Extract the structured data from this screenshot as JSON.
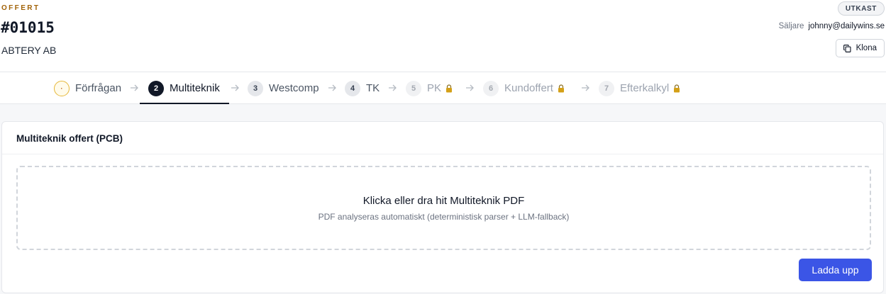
{
  "header": {
    "eyebrow": "OFFERT",
    "order_number": "#01015",
    "customer": "ABTERY AB",
    "status_badge": "UTKAST",
    "seller_label": "Säljare",
    "seller_value": "johnny@dailywins.se",
    "clone_label": "Klona"
  },
  "stepper": {
    "steps": [
      {
        "number": "·",
        "label": "Förfrågan",
        "state": "pending",
        "locked": false
      },
      {
        "number": "2",
        "label": "Multiteknik",
        "state": "active",
        "locked": false
      },
      {
        "number": "3",
        "label": "Westcomp",
        "state": "default",
        "locked": false
      },
      {
        "number": "4",
        "label": "TK",
        "state": "default",
        "locked": false
      },
      {
        "number": "5",
        "label": "PK",
        "state": "locked",
        "locked": true
      },
      {
        "number": "6",
        "label": "Kundoffert",
        "state": "locked",
        "locked": true
      },
      {
        "number": "7",
        "label": "Efterkalkyl",
        "state": "locked",
        "locked": true
      }
    ]
  },
  "card": {
    "title": "Multiteknik offert (PCB)",
    "dropzone_title": "Klicka eller dra hit Multiteknik PDF",
    "dropzone_subtitle": "PDF analyseras automatiskt (deterministisk parser + LLM-fallback)",
    "upload_label": "Ladda upp"
  },
  "colors": {
    "accent": "#3b55e6",
    "eyebrow": "#a16207",
    "active_step": "#111827",
    "pending_ring": "#e6b83a",
    "lock": "#d4a017"
  }
}
